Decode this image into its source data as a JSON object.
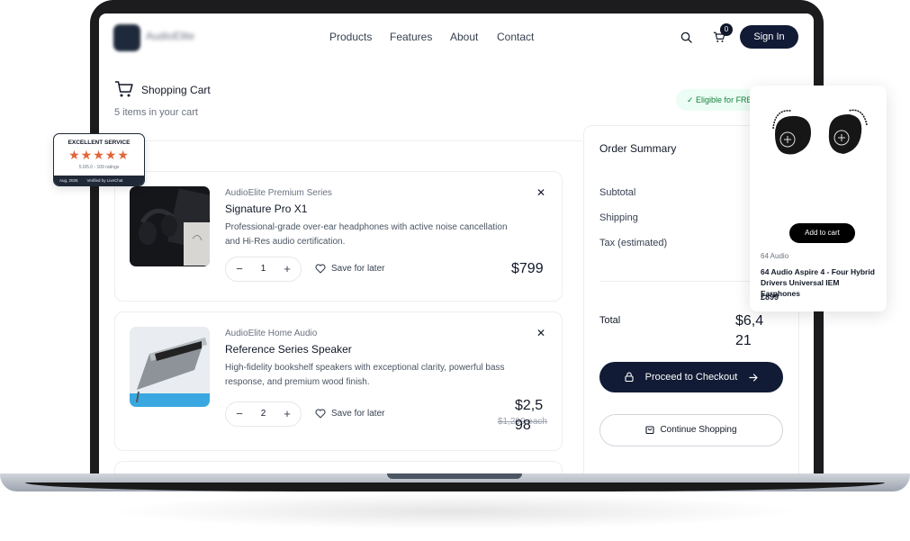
{
  "nav": {
    "logo_text": "AudioElite",
    "links": [
      "Products",
      "Features",
      "About",
      "Contact"
    ],
    "cart_count": "0",
    "signin_label": "Sign In"
  },
  "cart": {
    "title": "Shopping Cart",
    "subtitle": "5 items in your cart",
    "eligible": "✓ Eligible for FREE shipping",
    "save_label": "Save for later",
    "items": [
      {
        "series": "AudioElite Premium Series",
        "name": "Signature Pro X1",
        "desc": "Professional-grade over-ear headphones with active noise cancellation and Hi-Res audio certification.",
        "qty": "1",
        "price": "$799",
        "old_price": ""
      },
      {
        "series": "AudioElite Home Audio",
        "name": "Reference Series Speaker",
        "desc": "High-fidelity bookshelf speakers with exceptional clarity, powerful bass response, and premium wood finish.",
        "qty": "2",
        "price": "$2,598",
        "old_price": "$1,299 each"
      }
    ]
  },
  "summary": {
    "title": "Order Summary",
    "subtotal_label": "Subtotal",
    "shipping_label": "Shipping",
    "tax_label": "Tax (estimated)",
    "total_label": "Total",
    "total_value": "$6,421",
    "checkout_label": "Proceed to Checkout",
    "continue_label": "Continue Shopping"
  },
  "product_card": {
    "add_label": "Add to cart",
    "brand": "64 Audio",
    "name": "64 Audio Aspire 4 - Four Hybrid Drivers Universal IEM Earphones",
    "price": "£899"
  },
  "service_badge": {
    "title": "EXCELLENT SERVICE",
    "stars": "★★★★★",
    "rating": "5.0/5.0 - 109 ratings",
    "date": "Aug, 2025",
    "verified": "Verified by LiveChat"
  },
  "colors": {
    "primary": "#111b35",
    "star": "#e0653a",
    "eligible_bg": "#ecfdf5",
    "eligible_text": "#15803d"
  }
}
